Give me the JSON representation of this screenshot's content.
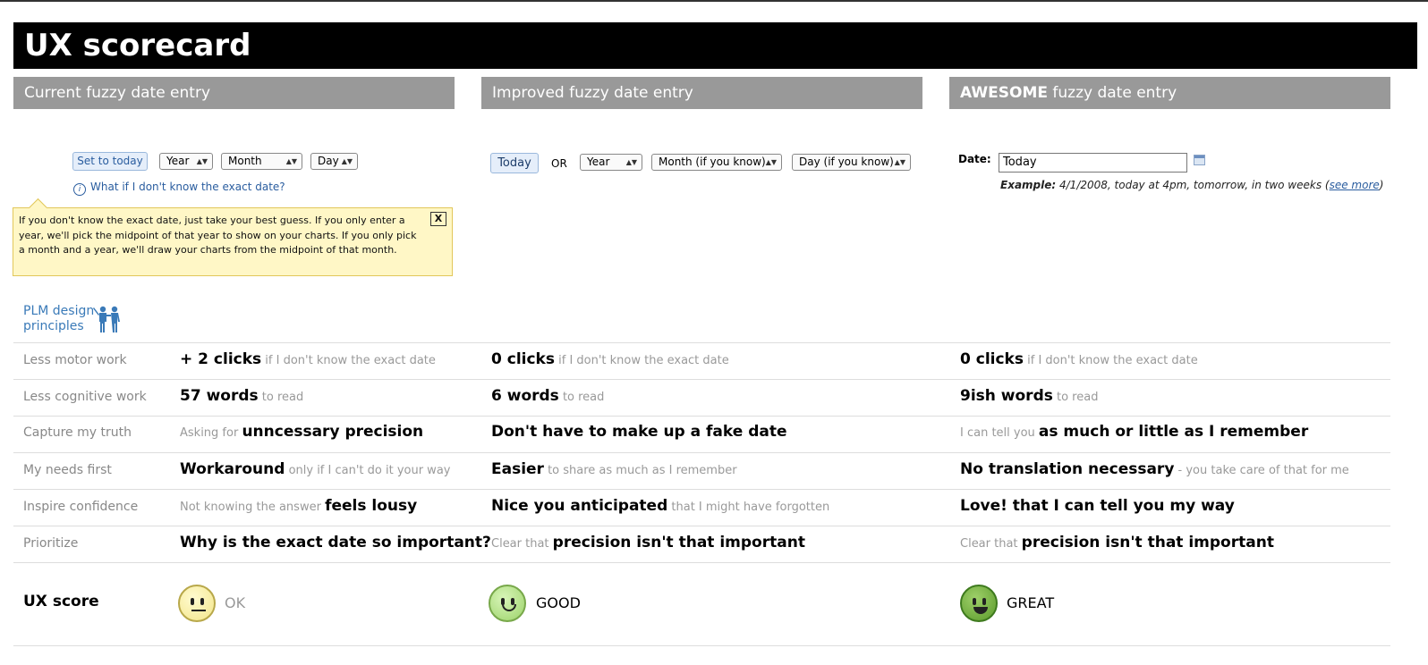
{
  "title": "UX scorecard",
  "columns": [
    {
      "label_strong": "",
      "label": "Current fuzzy date entry"
    },
    {
      "label_strong": "",
      "label": "Improved fuzzy date entry"
    },
    {
      "label_strong": "AWESOME",
      "label": " fuzzy date entry"
    }
  ],
  "current": {
    "set_today": "Set to today",
    "year": "Year",
    "month": "Month",
    "day": "Day",
    "info_link": "What if I don't know the exact date?",
    "tooltip": "If you don't know the exact date, just take your best guess. If you only enter a year, we'll pick the midpoint of that year to show on your charts. If you only pick a month and a year, we'll draw your charts from the midpoint of that month.",
    "close": "X"
  },
  "improved": {
    "today": "Today",
    "or": "OR",
    "year": "Year",
    "month": "Month (if you know)",
    "day": "Day (if you know)"
  },
  "awesome": {
    "date_label": "Date:",
    "date_value": "Today",
    "example_label": "Example:",
    "example_text": " 4/1/2008, today at 4pm, tomorrow, in two weeks (",
    "see_more": "see more",
    "example_close": ")"
  },
  "plm": {
    "line1": "PLM design",
    "line2": "principles"
  },
  "rows": [
    {
      "label": "Less motor work",
      "c1": {
        "pre": "",
        "big": "+ 2 clicks",
        "post": " if I don't know the exact date"
      },
      "c2": {
        "pre": "",
        "big": "0 clicks",
        "post": " if I don't know the exact date"
      },
      "c3": {
        "pre": "",
        "big": "0 clicks",
        "post": " if I don't know the exact date"
      }
    },
    {
      "label": "Less cognitive work",
      "c1": {
        "pre": "",
        "big": "57 words",
        "post": " to read"
      },
      "c2": {
        "pre": "",
        "big": "6 words",
        "post": " to read"
      },
      "c3": {
        "pre": "",
        "big": "9ish words",
        "post": " to read"
      }
    },
    {
      "label": "Capture my truth",
      "c1": {
        "pre": "Asking for ",
        "big": "unncessary precision",
        "post": ""
      },
      "c2": {
        "pre": "",
        "big": "Don't have to make up a fake date",
        "post": ""
      },
      "c3": {
        "pre": "I can tell you ",
        "big": "as much or little as I remember",
        "post": ""
      }
    },
    {
      "label": "My needs first",
      "c1": {
        "pre": "",
        "big": "Workaround",
        "post": " only if I can't do it your way"
      },
      "c2": {
        "pre": "",
        "big": "Easier",
        "post": " to share as much as I remember"
      },
      "c3": {
        "pre": "",
        "big": "No translation necessary",
        "post": " - you take care of that for me"
      }
    },
    {
      "label": "Inspire confidence",
      "c1": {
        "pre": "Not knowing the answer ",
        "big": "feels lousy",
        "post": ""
      },
      "c2": {
        "pre": "",
        "big": "Nice you anticipated",
        "post": " that I might have forgotten"
      },
      "c3": {
        "pre": "",
        "big": "Love! that I can tell you my way",
        "post": ""
      }
    },
    {
      "label": "Prioritize",
      "c1": {
        "pre": "",
        "big": "Why is the exact date so important?",
        "post": ""
      },
      "c2": {
        "pre": "Clear that ",
        "big": "precision isn't that important",
        "post": ""
      },
      "c3": {
        "pre": "Clear that ",
        "big": "precision isn't that important",
        "post": ""
      }
    }
  ],
  "score": {
    "label": "UX score",
    "c1": "OK",
    "c2": "GOOD",
    "c3": "GREAT",
    "colors": {
      "ok": "#f3e58a",
      "good": "#9cd36a",
      "great": "#5a9a2a"
    }
  },
  "icons": [
    "info-icon",
    "close-icon",
    "calendar-icon",
    "people-icon",
    "neutral-face-icon",
    "smile-face-icon",
    "big-smile-face-icon"
  ]
}
